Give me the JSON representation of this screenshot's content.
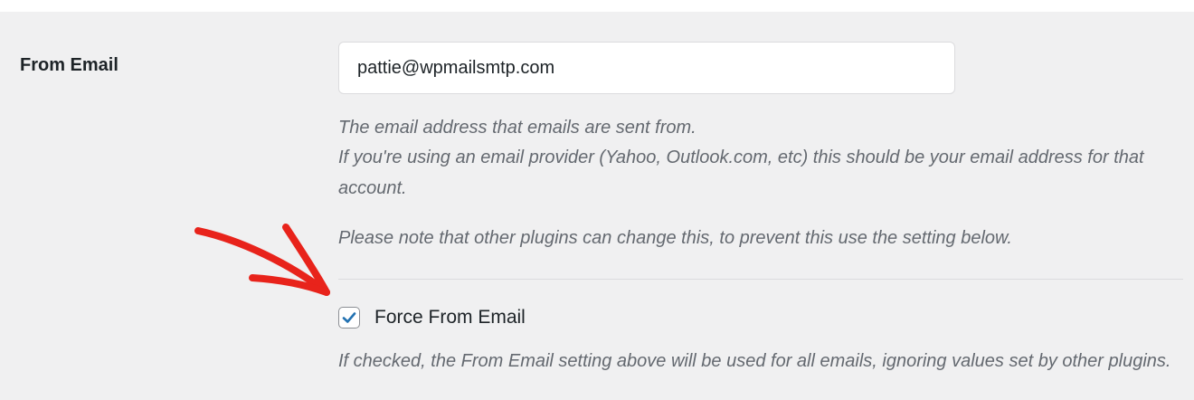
{
  "settings": {
    "from_email": {
      "label": "From Email",
      "value": "pattie@wpmailsmtp.com",
      "description_line1": "The email address that emails are sent from.",
      "description_line2": "If you're using an email provider (Yahoo, Outlook.com, etc) this should be your email address for that account.",
      "note": "Please note that other plugins can change this, to prevent this use the setting below."
    },
    "force_from_email": {
      "label": "Force From Email",
      "checked": true,
      "description": "If checked, the From Email setting above will be used for all emails, ignoring values set by other plugins."
    }
  },
  "icons": {
    "checkmark": "check-icon",
    "annotation_arrow": "red-arrow-icon"
  },
  "colors": {
    "panel_background": "#f0f0f1",
    "checkbox_accent": "#2271b1",
    "annotation_red": "#e8231b",
    "description_text": "#646970"
  }
}
